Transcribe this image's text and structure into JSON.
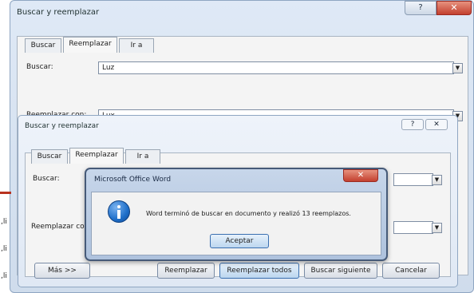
{
  "back_dialog": {
    "title": "Buscar y reemplazar",
    "help_label": "?",
    "close_label": "✕",
    "tabs": [
      "Buscar",
      "Reemplazar",
      "Ir a"
    ],
    "find_label": "Buscar:",
    "find_value": "Luz",
    "replace_label": "Reemplazar con:",
    "replace_value": "Lux"
  },
  "front_dialog": {
    "title": "Buscar y reemplazar",
    "help_label": "?",
    "close_label": "✕",
    "tabs": [
      "Buscar",
      "Reemplazar",
      "Ir a"
    ],
    "find_label": "Buscar:",
    "replace_label": "Reemplazar co",
    "buttons": {
      "more": "Más >>",
      "replace": "Reemplazar",
      "replace_all": "Reemplazar todos",
      "find_next": "Buscar siguiente",
      "cancel": "Cancelar"
    }
  },
  "message_box": {
    "title": "Microsoft Office Word",
    "close_label": "✕",
    "icon": "info-icon",
    "message": "Word terminó de buscar en documento y realizó 13 reemplazos.",
    "ok_label": "Aceptar"
  },
  "left_edge_text": [
    ",li",
    ",li",
    ",li"
  ],
  "colors": {
    "close_red": "#c3402f",
    "title_blue": "#c7d6ea",
    "info_blue": "#1f6fc9"
  }
}
